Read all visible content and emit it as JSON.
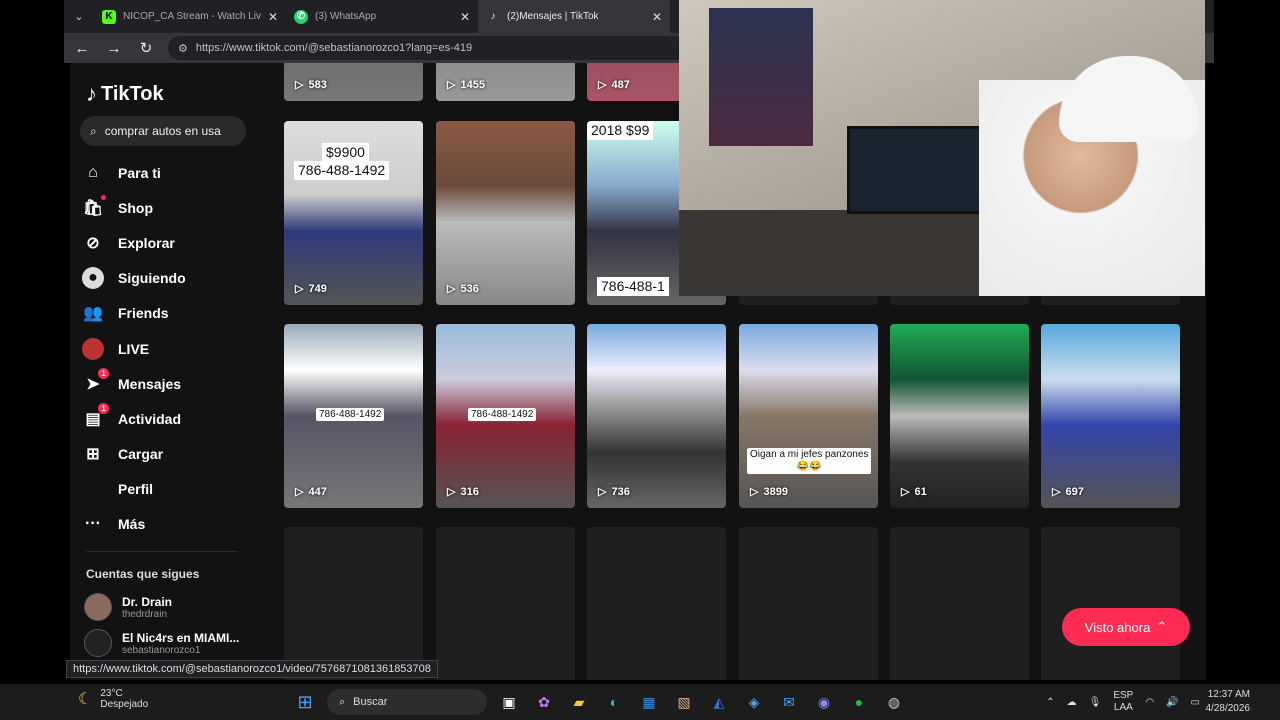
{
  "browser": {
    "tabs": [
      {
        "title": "NICOP_CA Stream - Watch Live on",
        "icon": "kick-icon",
        "color": "#53fc18"
      },
      {
        "title": "(3) WhatsApp",
        "icon": "whatsapp-icon",
        "color": "#25d366"
      },
      {
        "title": "(2)Mensajes | TikTok",
        "icon": "tiktok-icon",
        "color": "#ffffff"
      }
    ],
    "url": "https://www.tiktok.com/@sebastianorozco1?lang=es-419",
    "status_url": "https://www.tiktok.com/@sebastianorozco1/video/7576871081361853708"
  },
  "sidebar": {
    "logo": "TikTok",
    "search_text": "comprar autos en usa",
    "items": [
      {
        "label": "Para ti",
        "icon": "home-icon"
      },
      {
        "label": "Shop",
        "icon": "shop-bag-icon"
      },
      {
        "label": "Explorar",
        "icon": "compass-icon"
      },
      {
        "label": "Siguiendo",
        "icon": "following-avatar-icon"
      },
      {
        "label": "Friends",
        "icon": "friends-icon"
      },
      {
        "label": "LIVE",
        "icon": "live-icon"
      },
      {
        "label": "Mensajes",
        "icon": "messages-icon",
        "badge": "1"
      },
      {
        "label": "Actividad",
        "icon": "activity-icon",
        "badge": "1"
      },
      {
        "label": "Cargar",
        "icon": "upload-icon"
      },
      {
        "label": "Perfil",
        "icon": "profile-icon"
      },
      {
        "label": "Más",
        "icon": "more-icon"
      }
    ],
    "following_title": "Cuentas que sigues",
    "following": [
      {
        "name": "Dr. Drain",
        "handle": "thedrdrain"
      },
      {
        "name": "El Nic4rs en MIAMI...",
        "handle": "sebastianorozco1"
      }
    ]
  },
  "videos": {
    "row1": [
      "583",
      "1455",
      "487"
    ],
    "row2": [
      {
        "views": "749",
        "caption_lines": [
          "$9900",
          "786-488-1492"
        ]
      },
      {
        "views": "536"
      },
      {
        "views": "",
        "caption_top": "2018 $99",
        "caption_bottom": "786-488-1"
      }
    ],
    "row3": [
      {
        "views": "447",
        "caption": "786-488-1492"
      },
      {
        "views": "316",
        "caption": "786-488-1492"
      },
      {
        "views": "736"
      },
      {
        "views": "3899",
        "caption": "Oigan a mi jefes panzones",
        "caption2": "😂😂"
      },
      {
        "views": "61"
      },
      {
        "views": "697"
      }
    ]
  },
  "visto_button": "Visto ahora",
  "taskbar": {
    "temperature": "23°C",
    "weather": "Despejado",
    "search": "Buscar",
    "lang1": "ESP",
    "lang2": "LAA",
    "time": "12:37 AM",
    "date": "4/28/2026"
  }
}
